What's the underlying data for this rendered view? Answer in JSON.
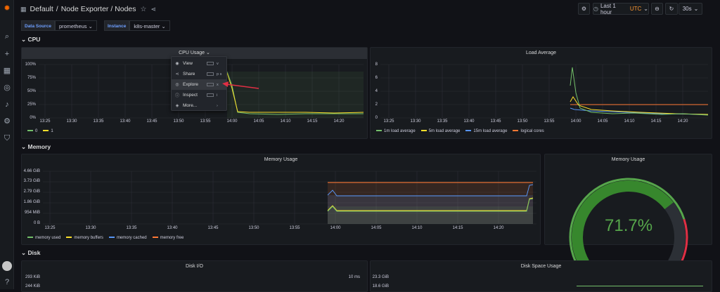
{
  "breadcrumb": {
    "folder": "Default",
    "sep": "/",
    "dashboard": "Node Exporter / Nodes"
  },
  "toolbar": {
    "time_range": "Last 1 hour",
    "timezone": "UTC",
    "refresh": "30s"
  },
  "variables": [
    {
      "label": "Data Source",
      "value": "prometheus"
    },
    {
      "label": "Instance",
      "value": "k8s-master"
    }
  ],
  "rows": {
    "cpu": "CPU",
    "memory": "Memory",
    "disk": "Disk"
  },
  "panels": {
    "cpu_usage": {
      "title": "CPU Usage",
      "y_ticks": [
        "100%",
        "75%",
        "50%",
        "25%",
        "0%"
      ],
      "x_ticks": [
        "13:25",
        "13:30",
        "13:35",
        "13:40",
        "13:45",
        "13:50",
        "13:55",
        "14:00",
        "14:05",
        "14:10",
        "14:15",
        "14:20"
      ],
      "legend": [
        {
          "name": "0",
          "color": "#73bf69"
        },
        {
          "name": "1",
          "color": "#fade2a"
        }
      ]
    },
    "load_average": {
      "title": "Load Average",
      "y_ticks": [
        "8",
        "6",
        "4",
        "2",
        "0"
      ],
      "x_ticks": [
        "13:25",
        "13:30",
        "13:35",
        "13:40",
        "13:45",
        "13:50",
        "13:55",
        "14:00",
        "14:05",
        "14:10",
        "14:15",
        "14:20"
      ],
      "legend": [
        {
          "name": "1m load average",
          "color": "#73bf69"
        },
        {
          "name": "5m load average",
          "color": "#fade2a"
        },
        {
          "name": "15m load average",
          "color": "#5794f2"
        },
        {
          "name": "logical cores",
          "color": "#ff7834"
        }
      ]
    },
    "memory_usage": {
      "title": "Memory Usage",
      "y_ticks": [
        "4.66 GiB",
        "3.73 GiB",
        "2.79 GiB",
        "1.86 GiB",
        "954 MiB",
        "0 B"
      ],
      "x_ticks": [
        "13:25",
        "13:30",
        "13:35",
        "13:40",
        "13:45",
        "13:50",
        "13:55",
        "14:00",
        "14:05",
        "14:10",
        "14:15",
        "14:20"
      ],
      "legend": [
        {
          "name": "memory used",
          "color": "#73bf69"
        },
        {
          "name": "memory buffers",
          "color": "#fade2a"
        },
        {
          "name": "memory cached",
          "color": "#5794f2"
        },
        {
          "name": "memory free",
          "color": "#ff7834"
        }
      ]
    },
    "memory_gauge": {
      "title": "Memory Usage",
      "value": "71.7%",
      "fraction": 0.717
    },
    "disk_io": {
      "title": "Disk I/O",
      "y_ticks": [
        "293 KiB",
        "244 KiB"
      ],
      "right_tick": "10 ms"
    },
    "disk_space": {
      "title": "Disk Space Usage",
      "y_ticks": [
        "23.3 GiB",
        "18.6 GiB"
      ]
    }
  },
  "context_menu": [
    {
      "icon": "eye-icon",
      "label": "View",
      "shortcut": "v"
    },
    {
      "icon": "share-icon",
      "label": "Share",
      "shortcut": "p s"
    },
    {
      "icon": "compass-icon",
      "label": "Explore",
      "shortcut": "x"
    },
    {
      "icon": "info-icon",
      "label": "Inspect",
      "shortcut": "i"
    },
    {
      "icon": "cube-icon",
      "label": "More...",
      "shortcut": ""
    }
  ]
}
